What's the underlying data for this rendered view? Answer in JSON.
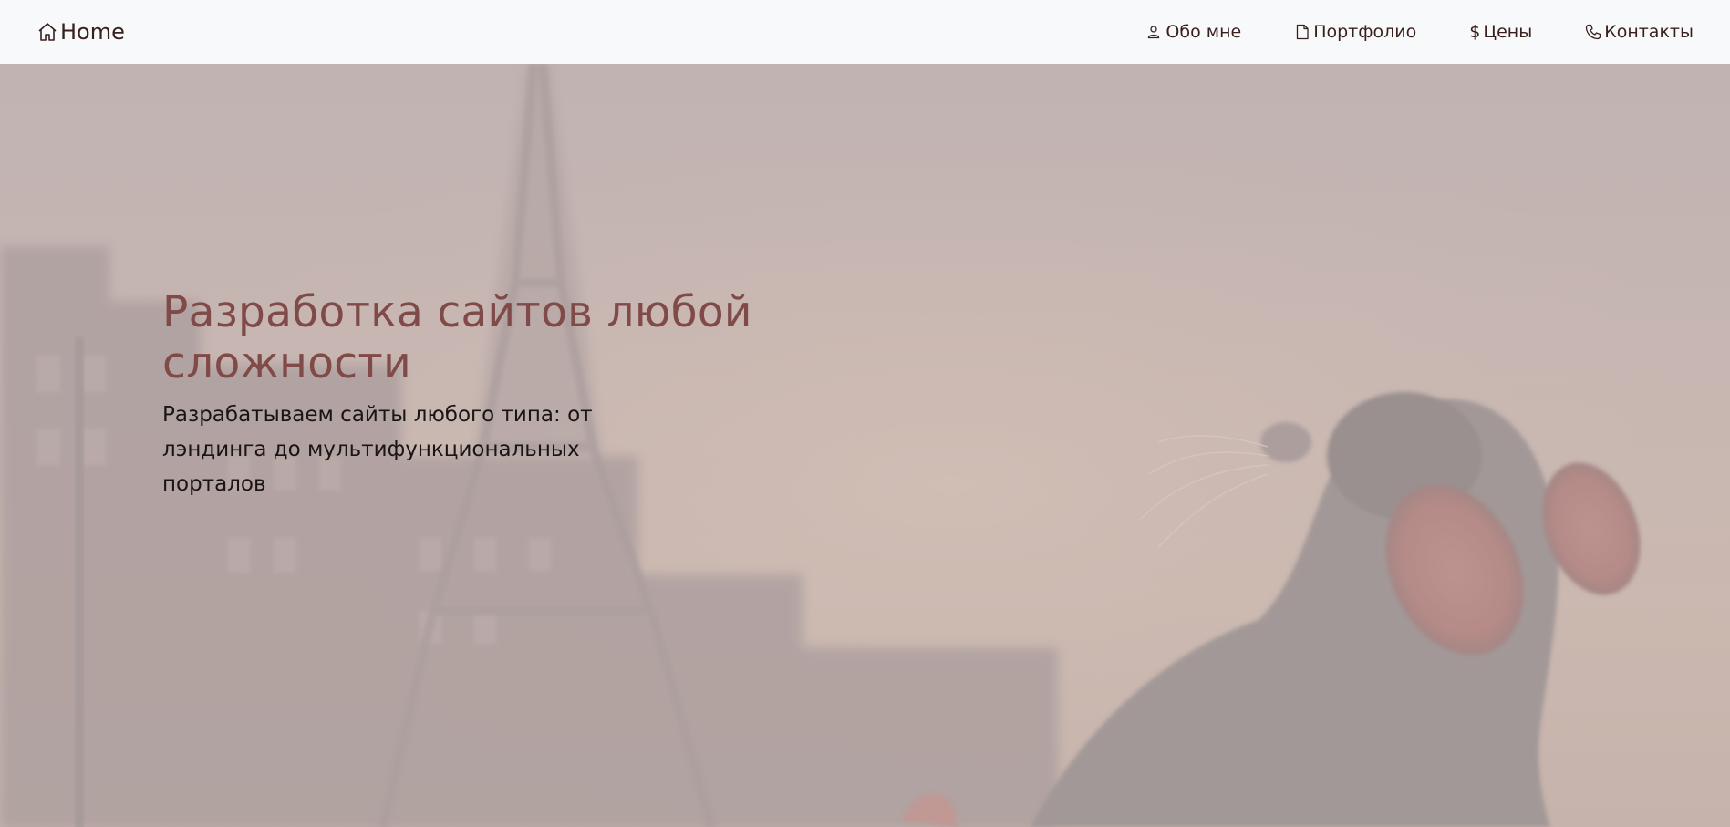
{
  "navbar": {
    "brand_label": "Home",
    "brand_icon": "house-icon",
    "links": [
      {
        "label": "Обо мне",
        "icon": "person-icon"
      },
      {
        "label": "Портфолио",
        "icon": "document-icon"
      },
      {
        "label": "Цены",
        "icon": "dollar-icon"
      },
      {
        "label": "Контакты",
        "icon": "phone-icon"
      }
    ],
    "background": "#f8f9fb",
    "text_color": "#3a1f1f"
  },
  "hero": {
    "title": "Разработка сайтов любой сложности",
    "subtitle": "Разрабатываем сайты любого типа: от лэндинга до мультифункциональных порталов",
    "title_color": "#7f4a48",
    "background_image": "eiffel-tower-and-rat-illustration"
  }
}
